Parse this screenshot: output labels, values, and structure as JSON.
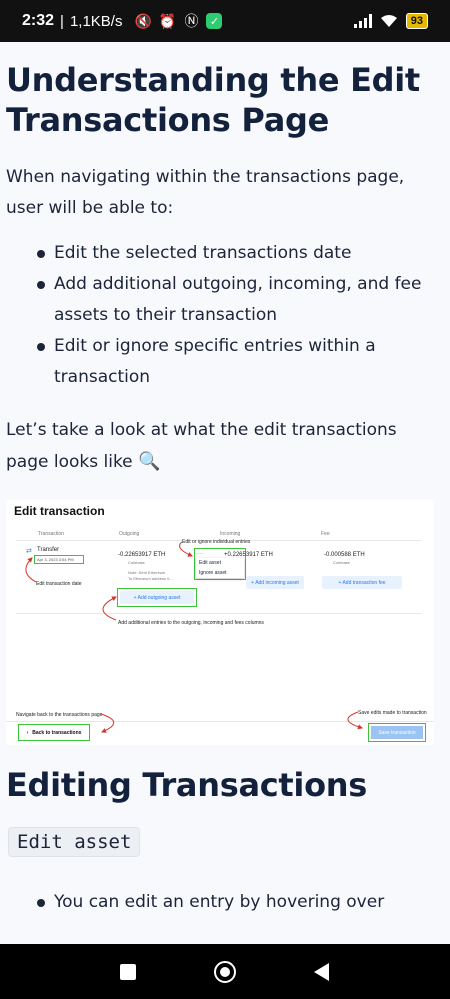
{
  "status_bar": {
    "time": "2:32",
    "speed": "1,1KB/s",
    "battery": "93",
    "icons": [
      "mute-icon",
      "alarm-icon",
      "nfc-icon",
      "shield-icon",
      "signal-icon",
      "wifi-icon",
      "battery-icon"
    ]
  },
  "section1": {
    "title": "Understanding the Edit Transactions Page",
    "intro": "When navigating within the transactions page, user will be able to:",
    "bullets": [
      "Edit the selected transactions date",
      "Add additional outgoing, incoming, and fee assets to their transaction",
      "Edit or ignore specific entries within a transaction"
    ],
    "lookahead": "Let’s take a look at what the edit transactions page looks like",
    "lookahead_emoji": "🔍"
  },
  "screenshot": {
    "title": "Edit transaction",
    "columns": [
      "Transaction",
      "Outgoing",
      "Incoming",
      "Fee"
    ],
    "transaction_type": "Transfer",
    "transaction_date": "Apr 3, 2023 3:54 PM",
    "outgoing_amount": "-0.22653917 ETH",
    "outgoing_source": "Coinbase",
    "outgoing_note": "Note: Sent Ethereum",
    "outgoing_note2": "To Ethereum address 0...",
    "incoming_amount": "+0.22653917 ETH",
    "fee_amount": "-0.000588 ETH",
    "fee_source": "Coinbase",
    "add_outgoing": "+ Add outgoing asset",
    "add_incoming": "+ Add incoming asset",
    "add_fee": "+ Add transaction fee",
    "menu_edit": "Edit asset",
    "menu_ignore": "Ignore asset",
    "annot_edit_ignore": "Edit or ignore individual entries",
    "annot_edit_date": "Edit transaction date",
    "annot_add_entries": "Add additional entries to the outgoing, incoming and fees columns",
    "annot_back": "Navigate back to the transactions page",
    "annot_save": "Save edits made to transaction",
    "back_label": "Back to transactions",
    "save_label": "Save transaction"
  },
  "section2": {
    "title": "Editing Transactions",
    "code": "Edit asset",
    "bullets": [
      "You can edit an entry by hovering over"
    ]
  },
  "colors": {
    "annotation_box": "#3ac43a",
    "annotation_arrow": "#d9342b",
    "primary_blue": "#2a78e4"
  }
}
